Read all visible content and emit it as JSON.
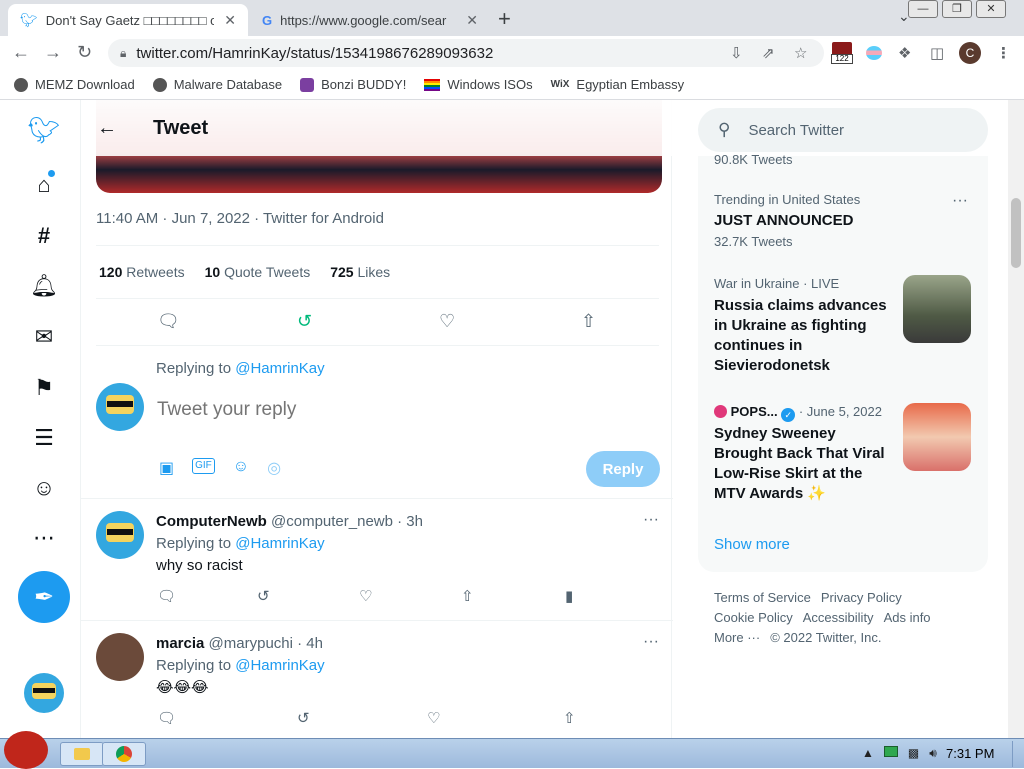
{
  "browser": {
    "tabs": [
      {
        "title": "Don't Say Gaetz □□□□□□□□ o",
        "close": "✕"
      },
      {
        "title": "https://www.google.com/sear",
        "close": "✕"
      }
    ],
    "new_tab": "+",
    "url": "twitter.com/HamrinKay/status/1534198676289093632",
    "extension_badge": "122",
    "profile_initial": "C",
    "bookmarks": [
      {
        "label": "MEMZ Download",
        "icon_color": "#555555"
      },
      {
        "label": "Malware Database",
        "icon_color": "#555555"
      },
      {
        "label": "Bonzi BUDDY!",
        "icon_color": "#7b3fa0"
      },
      {
        "label": "Windows ISOs",
        "icon_color": "#e23b3b"
      },
      {
        "label": "Egyptian Embassy",
        "icon_color": "#222222"
      }
    ]
  },
  "twitter": {
    "header_title": "Tweet",
    "meta": "11:40 AM · Jun 7, 2022 · Twitter for Android",
    "stats": {
      "retweets_count": "120",
      "retweets_label": "Retweets",
      "quotes_count": "10",
      "quotes_label": "Quote Tweets",
      "likes_count": "725",
      "likes_label": "Likes"
    },
    "compose": {
      "replying_prefix": "Replying to",
      "replying_handle": "@HamrinKay",
      "placeholder": "Tweet your reply",
      "reply_button": "Reply"
    },
    "replies": [
      {
        "name": "ComputerNewb",
        "handle": "@computer_newb · 3h",
        "replying_prefix": "Replying to",
        "replying_handle": "@HamrinKay",
        "text": "why so racist"
      },
      {
        "name": "marcia",
        "handle": "@marypuchi · 4h",
        "replying_prefix": "Replying to",
        "replying_handle": "@HamrinKay",
        "text": "😂😂😂"
      }
    ],
    "more_icon": "···"
  },
  "sidebar": {
    "search_placeholder": "Search Twitter",
    "trends": [
      {
        "count": "90.8K Tweets"
      },
      {
        "context": "Trending in United States",
        "title": "JUST ANNOUNCED",
        "count": "32.7K Tweets"
      }
    ],
    "news": [
      {
        "source": "War in Ukraine · LIVE",
        "headline": "Russia claims advances in Ukraine as fighting continues in Sievierodonetsk"
      },
      {
        "source": "POPS...",
        "date": "· June 5, 2022",
        "headline": "Sydney Sweeney Brought Back That Viral Low-Rise Skirt at the MTV Awards ✨"
      }
    ],
    "show_more": "Show more",
    "footer": {
      "terms": "Terms of Service",
      "privacy": "Privacy Policy",
      "cookie": "Cookie Policy",
      "accessibility": "Accessibility",
      "ads": "Ads info",
      "more": "More ···",
      "copyright": "© 2022 Twitter, Inc."
    }
  },
  "taskbar": {
    "time": "7:31 PM"
  },
  "colors": {
    "twitter_blue": "#1d9bf0",
    "reply_disabled": "#8ecdf8"
  }
}
